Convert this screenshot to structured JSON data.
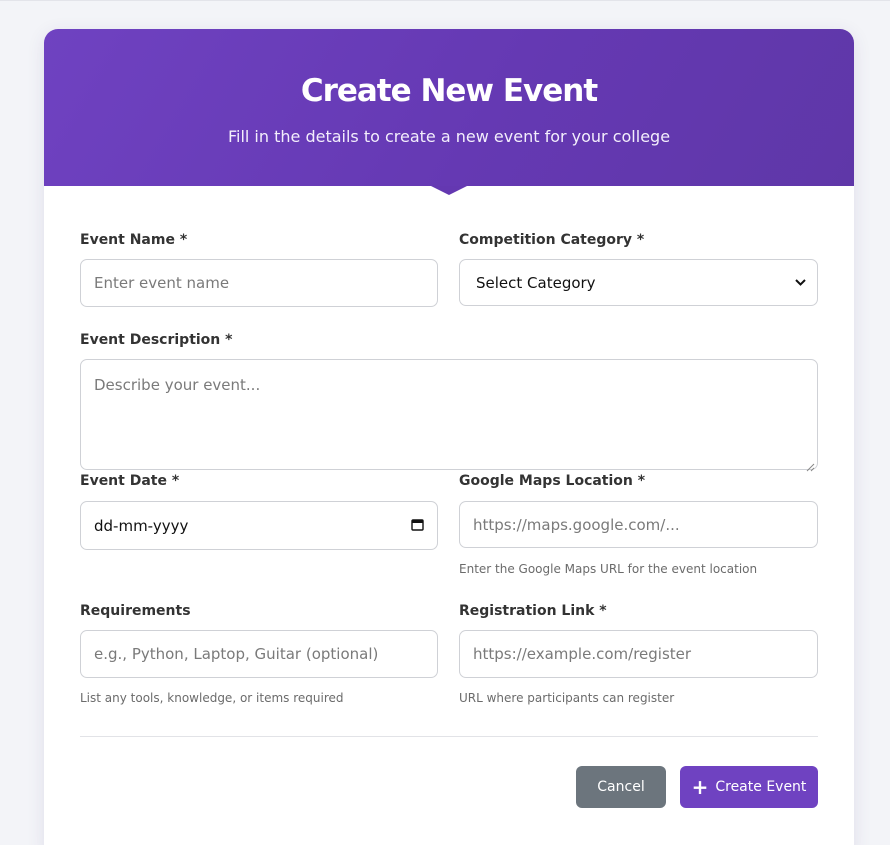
{
  "header": {
    "title": "Create New Event",
    "subtitle": "Fill in the details to create a new event for your college"
  },
  "form": {
    "event_name": {
      "label": "Event Name *",
      "placeholder": "Enter event name"
    },
    "category": {
      "label": "Competition Category *",
      "selected": "Select Category"
    },
    "description": {
      "label": "Event Description *",
      "placeholder": "Describe your event..."
    },
    "date": {
      "label": "Event Date *",
      "value": "dd-mm-yyyy"
    },
    "location": {
      "label": "Google Maps Location *",
      "placeholder": "https://maps.google.com/...",
      "hint": "Enter the Google Maps URL for the event location"
    },
    "requirements": {
      "label": "Requirements",
      "placeholder": "e.g., Python, Laptop, Guitar (optional)",
      "hint": "List any tools, knowledge, or items required"
    },
    "registration": {
      "label": "Registration Link *",
      "placeholder": "https://example.com/register",
      "hint": "URL where participants can register"
    }
  },
  "actions": {
    "cancel_label": "Cancel",
    "create_label": "Create Event",
    "create_icon": "plus-icon"
  },
  "colors": {
    "accent": "#6f42c1",
    "cancel": "#6c757d",
    "background": "#f3f4f8"
  }
}
